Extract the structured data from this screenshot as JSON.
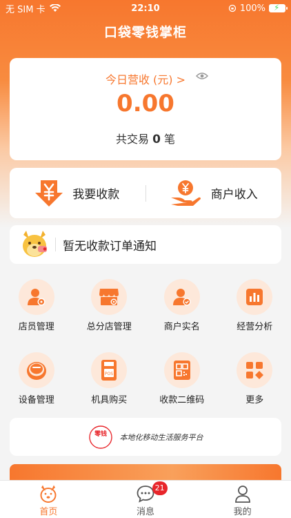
{
  "status_bar": {
    "carrier": "无 SIM 卡",
    "time": "22:10",
    "battery": "100%"
  },
  "header": {
    "title": "口袋零钱掌柜"
  },
  "revenue": {
    "label": "今日营收 (元) >",
    "amount": "0.00",
    "trade_prefix": "共交易",
    "trade_count": "0",
    "trade_suffix": "笔"
  },
  "actions": [
    {
      "label": "我要收款",
      "icon": "download-yen-icon"
    },
    {
      "label": "商户收入",
      "icon": "hand-coin-icon"
    }
  ],
  "notice": {
    "text": "暂无收款订单通知"
  },
  "grid": [
    {
      "label": "店员管理",
      "icon": "staff-icon"
    },
    {
      "label": "总分店管理",
      "icon": "store-icon"
    },
    {
      "label": "商户实名",
      "icon": "verify-user-icon"
    },
    {
      "label": "经营分析",
      "icon": "bar-chart-icon"
    },
    {
      "label": "设备管理",
      "icon": "device-icon"
    },
    {
      "label": "机具购买",
      "icon": "pos-icon"
    },
    {
      "label": "收款二维码",
      "icon": "qr-code-icon"
    },
    {
      "label": "更多",
      "icon": "more-grid-icon"
    }
  ],
  "banner": {
    "logo_text": "零钱",
    "slogan": "本地化移动生活服务平台"
  },
  "tabs": [
    {
      "label": "首页",
      "active": true
    },
    {
      "label": "消息",
      "badge": "21"
    },
    {
      "label": "我的"
    }
  ],
  "colors": {
    "accent": "#f7772e",
    "badge": "#e8262b"
  }
}
